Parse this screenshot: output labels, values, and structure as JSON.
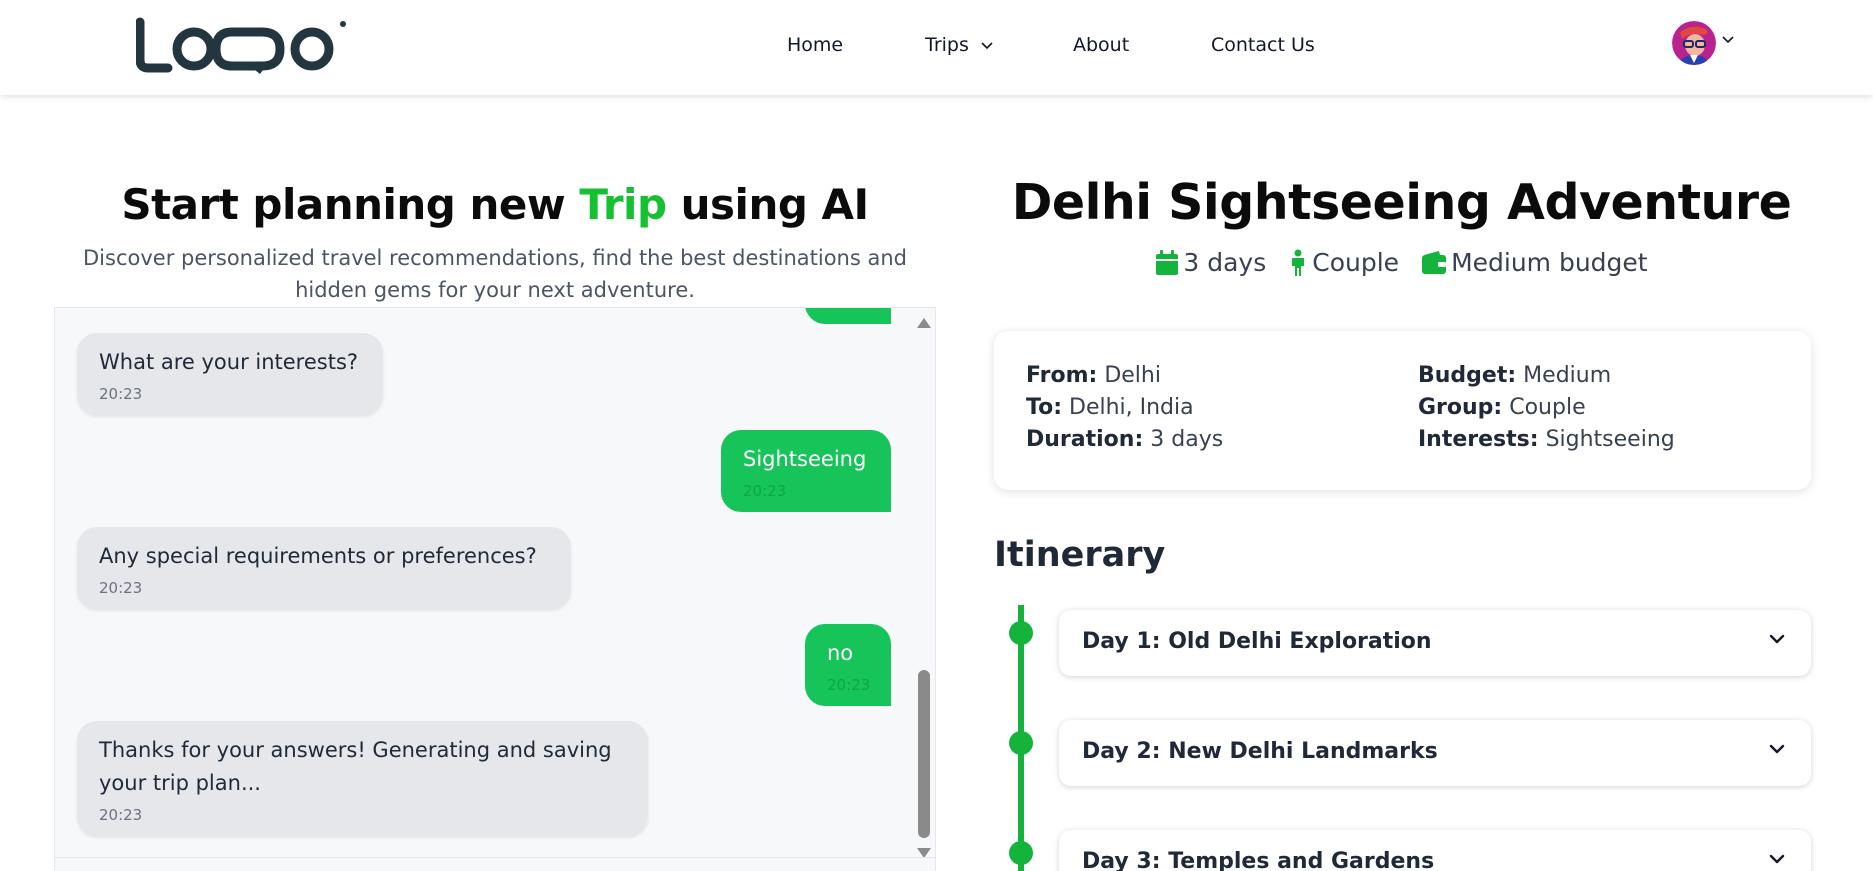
{
  "header": {
    "logo_text": "LOGO",
    "nav": [
      {
        "label": "Home"
      },
      {
        "label": "Trips"
      },
      {
        "label": "About"
      },
      {
        "label": "Contact Us"
      }
    ]
  },
  "planner": {
    "title_before": "Start planning new ",
    "title_highlight": "Trip",
    "title_after": " using AI",
    "subtitle": "Discover personalized travel recommendations, find the best destinations and hidden gems for your next adventure.",
    "messages": [
      {
        "role": "bot",
        "text": "What are your interests?",
        "time": "20:23"
      },
      {
        "role": "user",
        "text": "Sightseeing",
        "time": "20:23"
      },
      {
        "role": "bot",
        "text": "Any special requirements or preferences?",
        "time": "20:23"
      },
      {
        "role": "user",
        "text": "no",
        "time": "20:23"
      },
      {
        "role": "bot",
        "text": "Thanks for your answers! Generating and saving your trip plan...",
        "time": "20:23"
      }
    ]
  },
  "trip": {
    "title": "Delhi Sightseeing Adventure",
    "meta": {
      "duration": "3 days",
      "group": "Couple",
      "budget": "Medium budget"
    },
    "details": {
      "from_label": "From:",
      "from": "Delhi",
      "to_label": "To:",
      "to": "Delhi, India",
      "duration_label": "Duration:",
      "duration": "3 days",
      "budget_label": "Budget:",
      "budget": "Medium",
      "group_label": "Group:",
      "group": "Couple",
      "interests_label": "Interests:",
      "interests": "Sightseeing"
    },
    "itinerary_title": "Itinerary",
    "days": [
      {
        "title": "Day 1: Old Delhi Exploration"
      },
      {
        "title": "Day 2: New Delhi Landmarks"
      },
      {
        "title": "Day 3: Temples and Gardens"
      }
    ]
  },
  "colors": {
    "accent": "#16c131",
    "user_bubble": "#16c45a",
    "timeline": "#13b33c",
    "bot_bubble": "#e5e7eb"
  },
  "icons": {
    "duration": "calendar-icon",
    "group": "person-icon",
    "budget": "wallet-icon"
  }
}
